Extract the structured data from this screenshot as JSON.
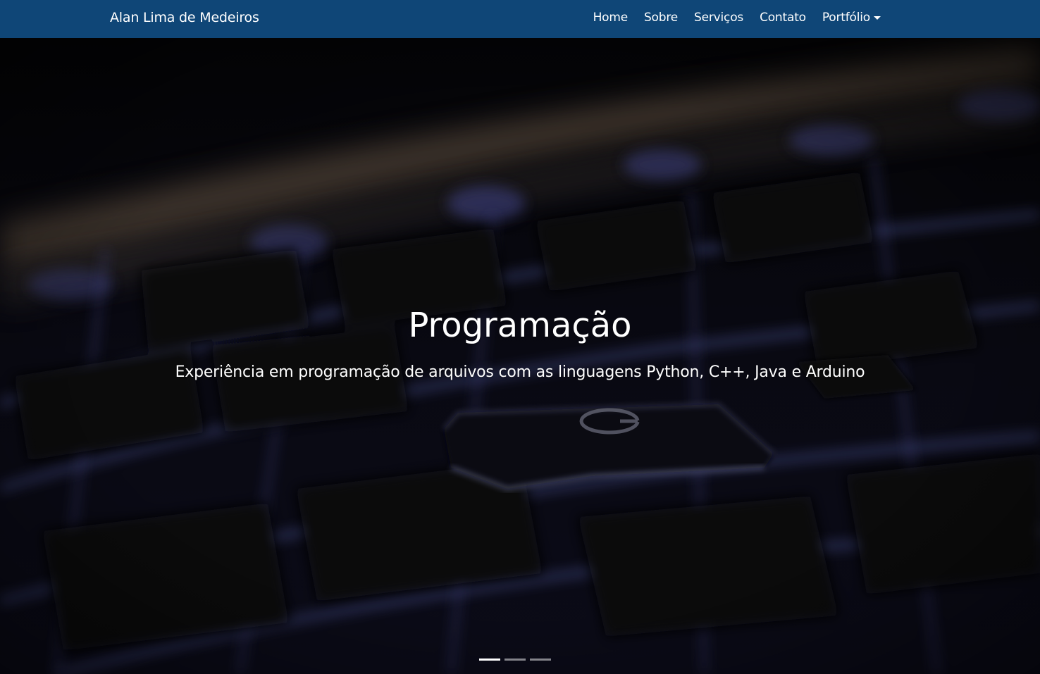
{
  "navbar": {
    "brand": "Alan Lima de Medeiros",
    "links": [
      {
        "label": "Home"
      },
      {
        "label": "Sobre"
      },
      {
        "label": "Serviços"
      },
      {
        "label": "Contato"
      },
      {
        "label": "Portfólio"
      }
    ],
    "background_color": "#0f4677"
  },
  "carousel": {
    "slide": {
      "title": "Programação",
      "description": "Experiência em programação de arquivos com as linguagens Python, C++, Java e Arduino"
    },
    "slide_count": 3,
    "active_index": 0
  }
}
